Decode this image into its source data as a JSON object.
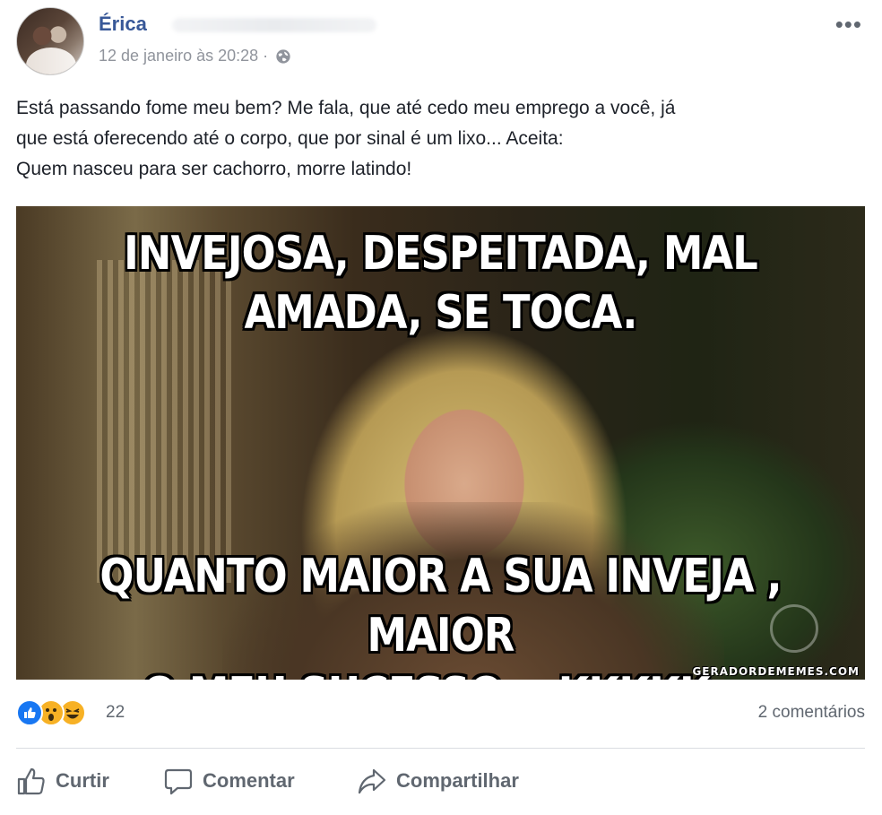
{
  "post": {
    "author": "Érica",
    "timestamp": "12 de janeiro às 20:28 ·",
    "more_icon": "more-options-icon",
    "text_lines": [
      "Está passando fome meu bem? Me fala, que até cedo meu emprego a você, já",
      "que está oferecendo até o corpo, que por sinal é um lixo... Aceita:",
      "Quem nasceu para ser cachorro, morre latindo!"
    ]
  },
  "image": {
    "top_caption_line1": "INVEJOSA, DESPEITADA, MAL",
    "top_caption_line2": "AMADA, SE TOCA.",
    "bottom_caption_line1": "QUANTO MAIOR A SUA INVEJA , MAIOR",
    "bottom_caption_line2": "O MEU SUCESSO... KKKKK..",
    "watermark": "GERADORDEMEMES.COM"
  },
  "reactions": {
    "count": "22",
    "comments": "2 comentários",
    "types": [
      "like-icon",
      "wow-icon",
      "haha-icon"
    ]
  },
  "actions": {
    "like_label": "Curtir",
    "comment_label": "Comentar",
    "share_label": "Compartilhar"
  },
  "colors": {
    "name": "#385898",
    "like_blue": "#1877f2",
    "reaction_yellow": "#f7b125",
    "muted": "#606770"
  }
}
